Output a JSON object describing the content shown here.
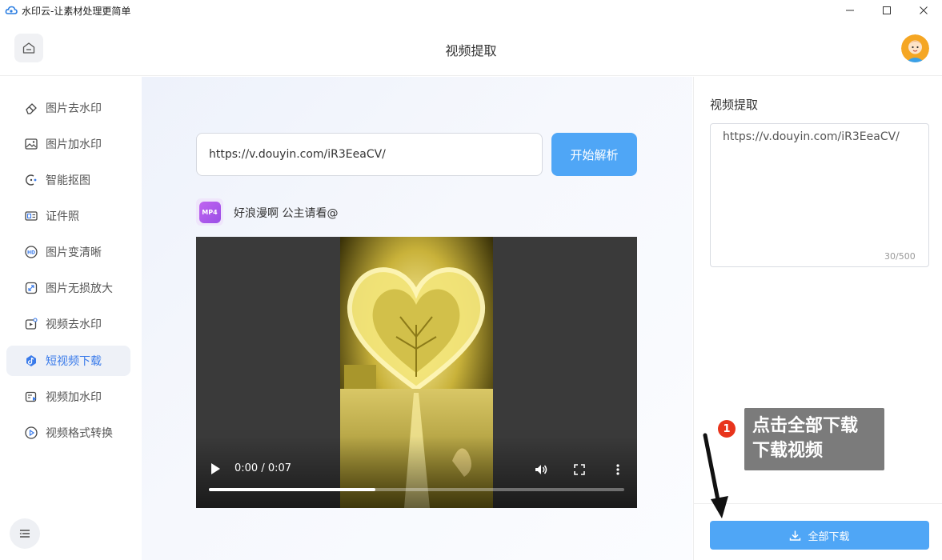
{
  "window": {
    "title": "水印云-让素材处理更简单"
  },
  "header": {
    "title": "视频提取"
  },
  "sidebar": {
    "items": [
      {
        "label": "图片去水印",
        "icon": "eraser-icon"
      },
      {
        "label": "图片加水印",
        "icon": "image-icon"
      },
      {
        "label": "智能抠图",
        "icon": "cutout-icon"
      },
      {
        "label": "证件照",
        "icon": "id-card-icon"
      },
      {
        "label": "图片变清晰",
        "icon": "hd-icon"
      },
      {
        "label": "图片无损放大",
        "icon": "enlarge-icon"
      },
      {
        "label": "视频去水印",
        "icon": "video-eraser-icon"
      },
      {
        "label": "短视频下载",
        "icon": "douyin-icon",
        "active": true
      },
      {
        "label": "视频加水印",
        "icon": "video-add-icon"
      },
      {
        "label": "视频格式转换",
        "icon": "video-convert-icon"
      }
    ]
  },
  "main": {
    "url_value": "https://v.douyin.com/iR3EeaCV/",
    "parse_button": "开始解析",
    "file_badge": "MP4",
    "video_title": "好浪漫啊 公主请看@",
    "player": {
      "time": "0:00 / 0:07",
      "progress": 0.4
    }
  },
  "right": {
    "label": "视频提取",
    "result_text": "https://v.douyin.com/iR3EeaCV/",
    "char_count": "30/500",
    "download_button": "全部下载"
  },
  "tutorial": {
    "step": "1",
    "line1": "点击全部下载",
    "line2": "下载视频"
  },
  "colors": {
    "accent": "#4fa6f6",
    "active_text": "#3a7bea",
    "tip_bg": "#7b7b7b",
    "tip_num": "#e8341c"
  }
}
